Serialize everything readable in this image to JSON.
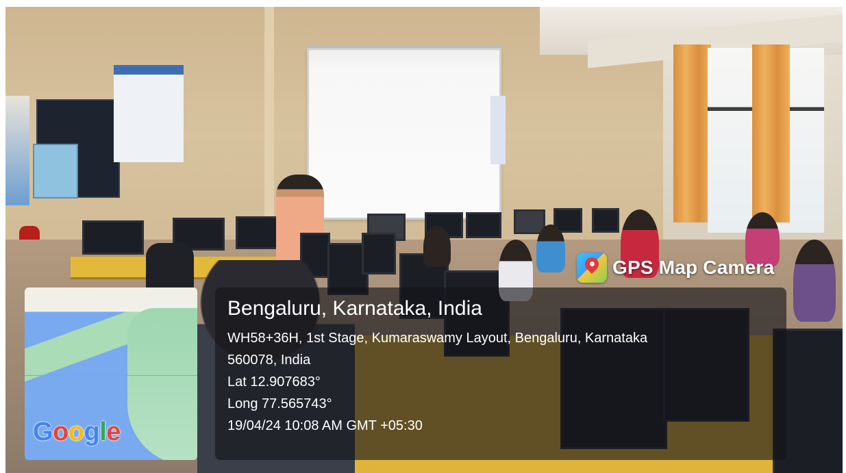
{
  "watermark": {
    "app_name": "GPS Map Camera",
    "icon": "map-pin-icon"
  },
  "map": {
    "provider_logo_letters": [
      "G",
      "o",
      "o",
      "g",
      "l",
      "e"
    ],
    "colors": {
      "water": "#79a9ee",
      "land": "#a9dcb7"
    }
  },
  "location": {
    "title": "Bengaluru, Karnataka, India",
    "address_line1": "WH58+36H, 1st Stage, Kumaraswamy Layout, Bengaluru, Karnataka",
    "address_line2": "560078, India",
    "latitude": "Lat 12.907683°",
    "longitude": "Long 77.565743°",
    "timestamp": "19/04/24 10:08 AM GMT +05:30"
  }
}
